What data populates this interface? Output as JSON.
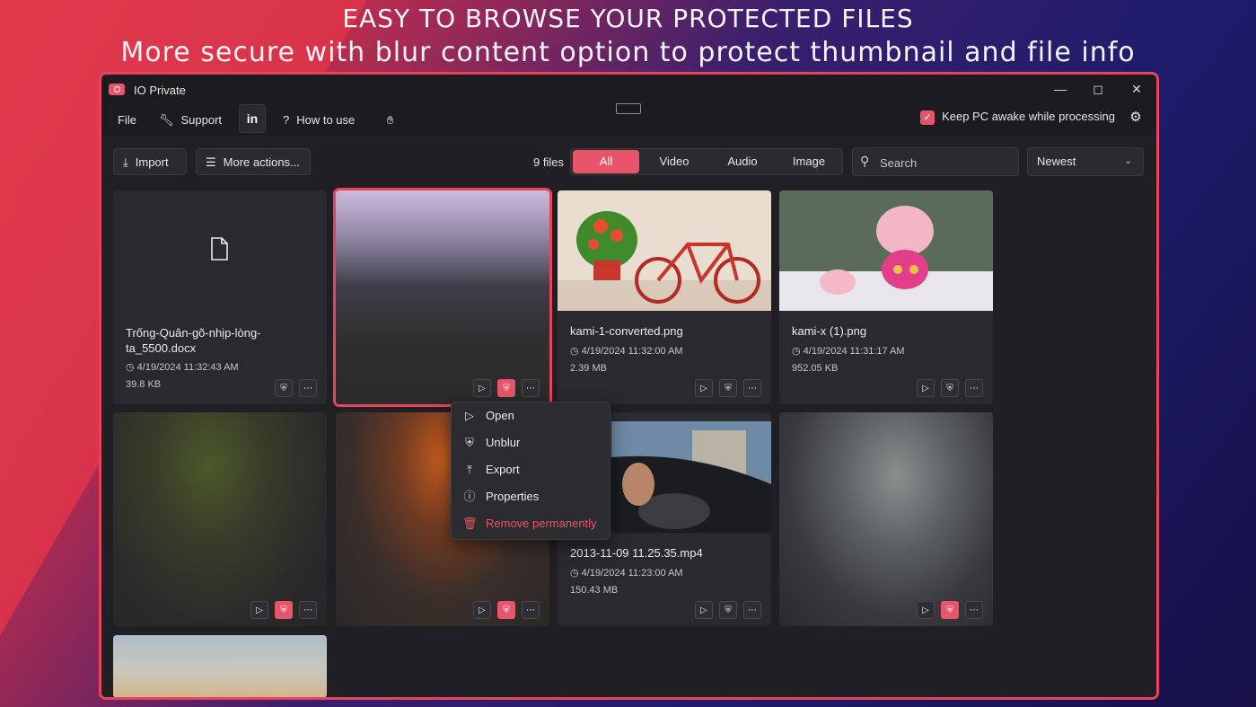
{
  "hero": {
    "line1": "EASY TO BROWSE YOUR PROTECTED FILES",
    "line2": "More secure with blur content option to protect thumbnail and file info"
  },
  "window": {
    "title": "IO Private",
    "controls": [
      "minimize-icon",
      "maximize-icon",
      "close-icon"
    ]
  },
  "menubar": {
    "file": "File",
    "support": "Support",
    "linkedin": "in",
    "how_to_use": "How to use",
    "keep_awake": "Keep PC awake while processing",
    "keep_awake_checked": true
  },
  "toolbar": {
    "import": "Import",
    "more_actions": "More actions...",
    "file_count": "9 files",
    "filters": [
      "All",
      "Video",
      "Audio",
      "Image"
    ],
    "active_filter": "All",
    "search_placeholder": "Search",
    "sort": "Newest"
  },
  "files": [
    {
      "name": "Trống-Quân-gõ-nhịp-lòng-ta_5500.docx",
      "date": "4/19/2024 11:32:43 AM",
      "size": "39.8 KB",
      "blurred": false
    },
    {
      "name": "",
      "date": "",
      "size": "",
      "blurred": true,
      "selected": true
    },
    {
      "name": "kami-1-converted.png",
      "date": "4/19/2024 11:32:00 AM",
      "size": "2.39 MB",
      "blurred": false
    },
    {
      "name": "kami-x (1).png",
      "date": "4/19/2024 11:31:17 AM",
      "size": "952.05 KB",
      "blurred": false
    },
    {
      "name": "",
      "date": "",
      "size": "",
      "blurred": true
    },
    {
      "name": "",
      "date": "",
      "size": "",
      "blurred": true
    },
    {
      "name": "2013-11-09 11.25.35.mp4",
      "date": "4/19/2024 11:23:00 AM",
      "size": "150.43 MB",
      "blurred": false
    },
    {
      "name": "",
      "date": "",
      "size": "",
      "blurred": true
    }
  ],
  "context_menu": {
    "open": "Open",
    "unblur": "Unblur",
    "export": "Export",
    "properties": "Properties",
    "remove": "Remove permanently"
  },
  "colors": {
    "accent": "#e8556a",
    "window_bg": "#1c1b1f",
    "content_bg": "#201f24"
  }
}
